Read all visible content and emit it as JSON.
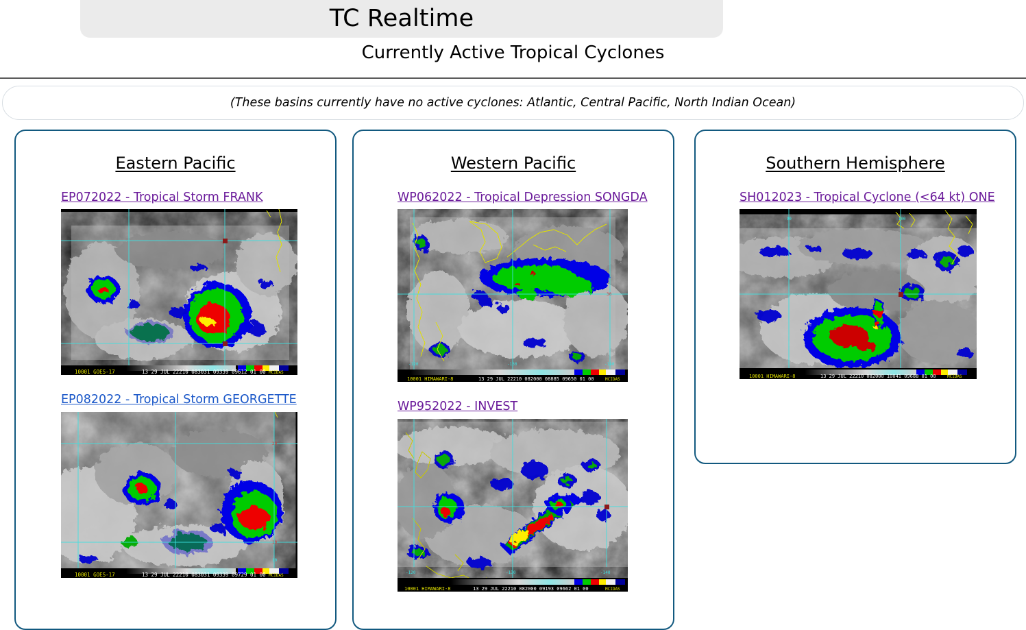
{
  "header": {
    "title": "TC Realtime",
    "subtitle": "Currently Active Tropical Cyclones",
    "notice": "(These basins currently have no active cyclones: Atlantic, Central Pacific, North Indian Ocean)"
  },
  "colors": {
    "panel_border": "#12597f",
    "banner_bg": "#ebebeb",
    "visited_link": "#6a1a9a",
    "unvisited_link": "#1a57c8",
    "divider": "#5a5a5a",
    "notice_border": "#d7dde2"
  },
  "panels": [
    {
      "id": "panel-ep",
      "title": "Eastern Pacific",
      "storms": [
        {
          "label": "EP072022 - Tropical Storm FRANK",
          "link_state": "visited",
          "image": {
            "satellite": "GOES-17",
            "caption": "10001 GOES-17    13 29 JUL 22210 083031 09339 09612 01 00",
            "caption_tag": "MCIDAS"
          }
        },
        {
          "label": "EP082022 - Tropical Storm GEORGETTE",
          "link_state": "unvisited",
          "image": {
            "satellite": "GOES-17",
            "caption": "10001 GOES-17    13 29 JUL 22210 083031 09339 09729 01 00",
            "caption_tag": "MCIDAS"
          }
        }
      ]
    },
    {
      "id": "panel-wp",
      "title": "Western Pacific",
      "storms": [
        {
          "label": "WP062022 - Tropical Depression SONGDA",
          "link_state": "visited",
          "image": {
            "satellite": "HIMAWARI-8",
            "caption": "10001 HIMAWARI-8 13 29 JUL 22210 082000 08885 09650 01 00",
            "caption_tag": "MCIDAS"
          }
        },
        {
          "label": "WP952022 - INVEST",
          "link_state": "visited",
          "image": {
            "satellite": "HIMAWARI-8",
            "caption": "10001 HIMAWARI-8 13 29 JUL 22210 082000 09193 09662 01 00",
            "caption_tag": "MCIDAS"
          }
        }
      ]
    },
    {
      "id": "panel-sh",
      "title": "Southern Hemisphere",
      "storms": [
        {
          "label": "SH012023 - Tropical Cyclone (<64 kt) ONE",
          "link_state": "visited",
          "image": {
            "satellite": "HIMAWARI-8",
            "caption": "10001 HIMAWARI-8 13 29 JUL 22210 082000 10041 09688 01 00",
            "caption_tag": "MCIDAS"
          }
        }
      ]
    }
  ]
}
